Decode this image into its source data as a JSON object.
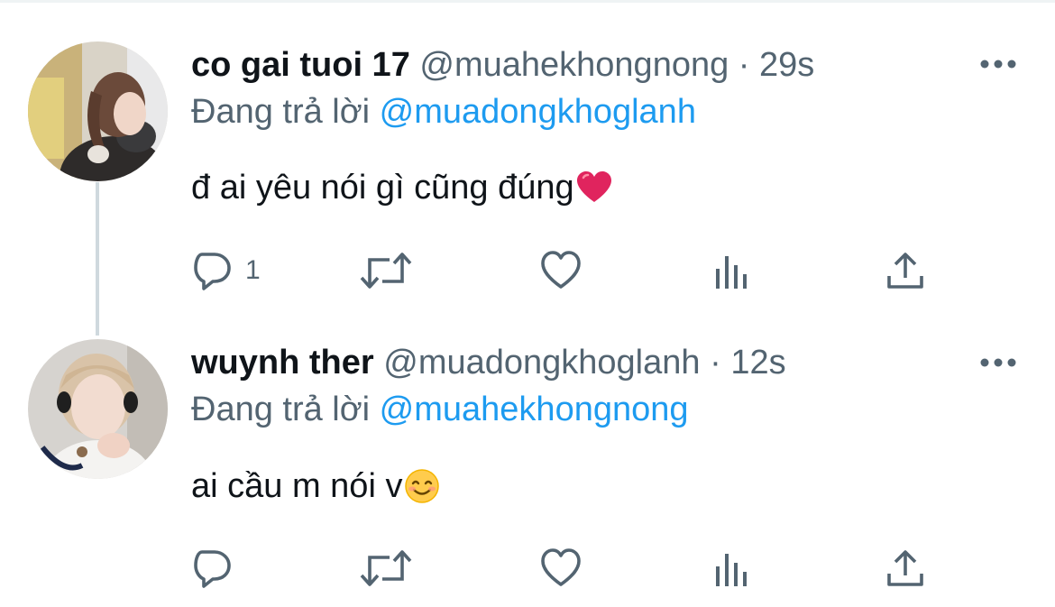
{
  "colors": {
    "text_primary": "#0f1419",
    "text_secondary": "#536471",
    "link": "#1d9bf0",
    "thread_line": "#cfd9de",
    "heart_emoji": "#e0245e"
  },
  "tweets": [
    {
      "display_name": "co gai tuoi 17",
      "handle": "@muahekhongnong",
      "separator": "·",
      "time": "29s",
      "reply_prefix": "Đang trả lời",
      "reply_to": "@muadongkhoglanh",
      "text": "đ ai yêu nói gì cũng đúng",
      "emoji": "red-heart",
      "reply_count": "1",
      "icons": [
        "reply-icon",
        "retweet-icon",
        "like-icon",
        "analytics-icon",
        "share-icon",
        "more-icon"
      ]
    },
    {
      "display_name": "wuynh ther",
      "handle": "@muadongkhoglanh",
      "separator": "·",
      "time": "12s",
      "reply_prefix": "Đang trả lời",
      "reply_to": "@muahekhongnong",
      "text": "ai cầu m nói v",
      "emoji": "smiling-face",
      "reply_count": "",
      "icons": [
        "reply-icon",
        "retweet-icon",
        "like-icon",
        "analytics-icon",
        "share-icon",
        "more-icon"
      ]
    }
  ]
}
